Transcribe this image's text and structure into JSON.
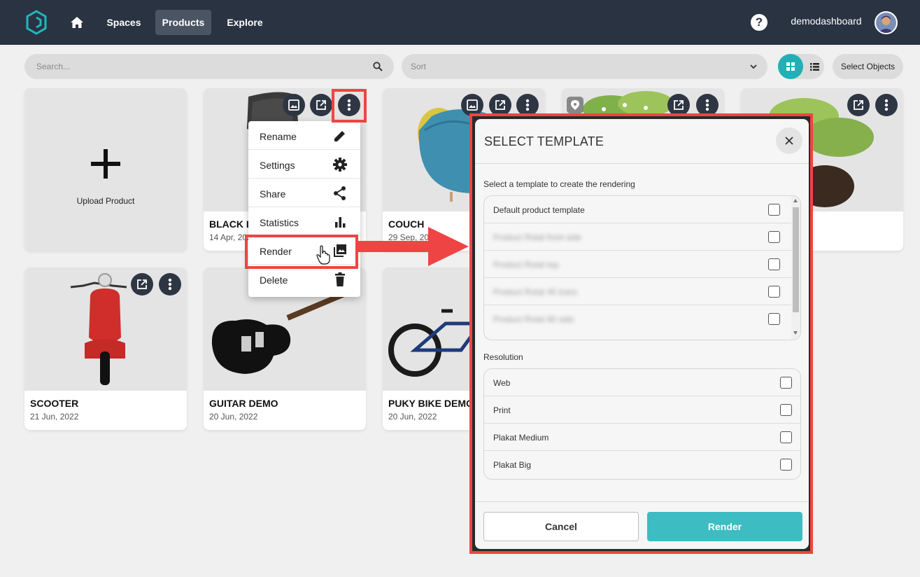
{
  "header": {
    "logo_icon": "cube-logo-icon",
    "home_icon": "home-icon",
    "nav": [
      {
        "label": "Spaces",
        "active": false
      },
      {
        "label": "Products",
        "active": true
      },
      {
        "label": "Explore",
        "active": false
      }
    ],
    "help_icon": "question-icon",
    "help_label": "?",
    "username": "demodashboard",
    "avatar_icon": "avatar-icon"
  },
  "toolbar": {
    "search_placeholder": "Search...",
    "search_icon": "search-icon",
    "sort_placeholder": "Sort",
    "sort_icon": "chevron-down-icon",
    "view_modes": [
      {
        "icon": "grid-view-icon",
        "active": true
      },
      {
        "icon": "list-view-icon",
        "active": false
      }
    ],
    "select_objects_label": "Select Objects",
    "accent_color": "#1fb1b5"
  },
  "upload": {
    "label": "Upload Product",
    "icon": "plus-icon"
  },
  "products": [
    {
      "name": "BLACK L",
      "date": "14 Apr, 202"
    },
    {
      "name": "COUCH",
      "date": "29 Sep, 202"
    },
    {
      "name": "",
      "date": ""
    },
    {
      "name": "",
      "date": ""
    },
    {
      "name": "SCOOTER",
      "date": "21 Jun, 2022"
    },
    {
      "name": "GUITAR DEMO",
      "date": "20 Jun, 2022"
    },
    {
      "name": "PUKY BIKE DEMO",
      "date": "20 Jun, 2022"
    }
  ],
  "context_menu": {
    "items": [
      {
        "label": "Rename",
        "icon": "pencil-icon"
      },
      {
        "label": "Settings",
        "icon": "gear-icon"
      },
      {
        "label": "Share",
        "icon": "share-icon"
      },
      {
        "label": "Statistics",
        "icon": "bar-chart-icon"
      },
      {
        "label": "Render",
        "icon": "image-icon"
      },
      {
        "label": "Delete",
        "icon": "trash-icon"
      }
    ]
  },
  "annotation_color": "#ef4444",
  "modal": {
    "title": "SELECT TEMPLATE",
    "close_icon": "close-icon",
    "template_prompt": "Select a template to create the rendering",
    "templates": [
      {
        "label": "Default product template",
        "checked": false,
        "blurred": false
      },
      {
        "label": "Product Rotat front side",
        "checked": false,
        "blurred": true
      },
      {
        "label": "Product Rotat top",
        "checked": false,
        "blurred": true
      },
      {
        "label": "Product Rotat 45 trans",
        "checked": false,
        "blurred": true
      },
      {
        "label": "Product Rotat 90 side",
        "checked": false,
        "blurred": true
      }
    ],
    "resolution_label": "Resolution",
    "resolutions": [
      {
        "label": "Web",
        "checked": false
      },
      {
        "label": "Print",
        "checked": false
      },
      {
        "label": "Plakat Medium",
        "checked": false
      },
      {
        "label": "Plakat Big",
        "checked": false
      }
    ],
    "cancel_label": "Cancel",
    "render_label": "Render",
    "render_color": "#3dbcc2"
  }
}
